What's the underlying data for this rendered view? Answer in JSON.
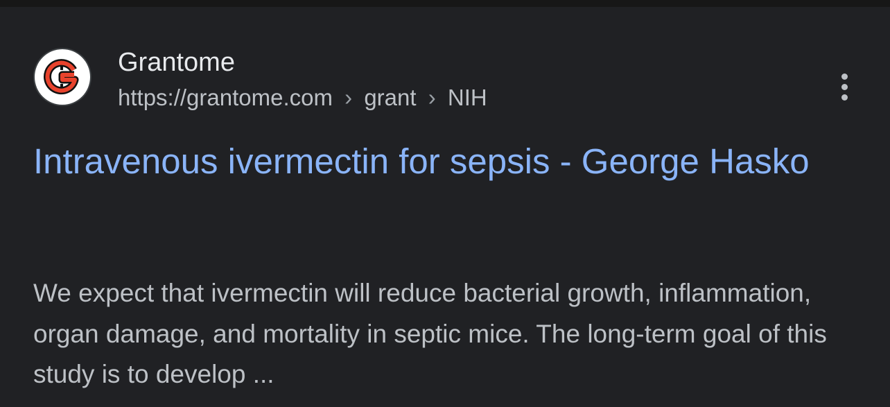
{
  "result": {
    "site_name": "Grantome",
    "favicon": {
      "icon": "grantome-logo-icon",
      "letter": "G",
      "accent_color": "#e8432d"
    },
    "breadcrumb": {
      "domain": "https://grantome.com",
      "separator": "›",
      "path": [
        "grant",
        "NIH"
      ]
    },
    "title": "Intravenous ivermectin for sepsis - George Hasko",
    "snippet": "We expect that ivermectin will reduce bacterial growth, inflammation, organ damage, and mortality in septic mice. The long-term goal of this study is to develop ...",
    "more_icon": "more-vert-icon"
  },
  "colors": {
    "background": "#202124",
    "title_link": "#8ab4f8",
    "site_name": "#e8eaed",
    "secondary_text": "#bdc1c6"
  }
}
